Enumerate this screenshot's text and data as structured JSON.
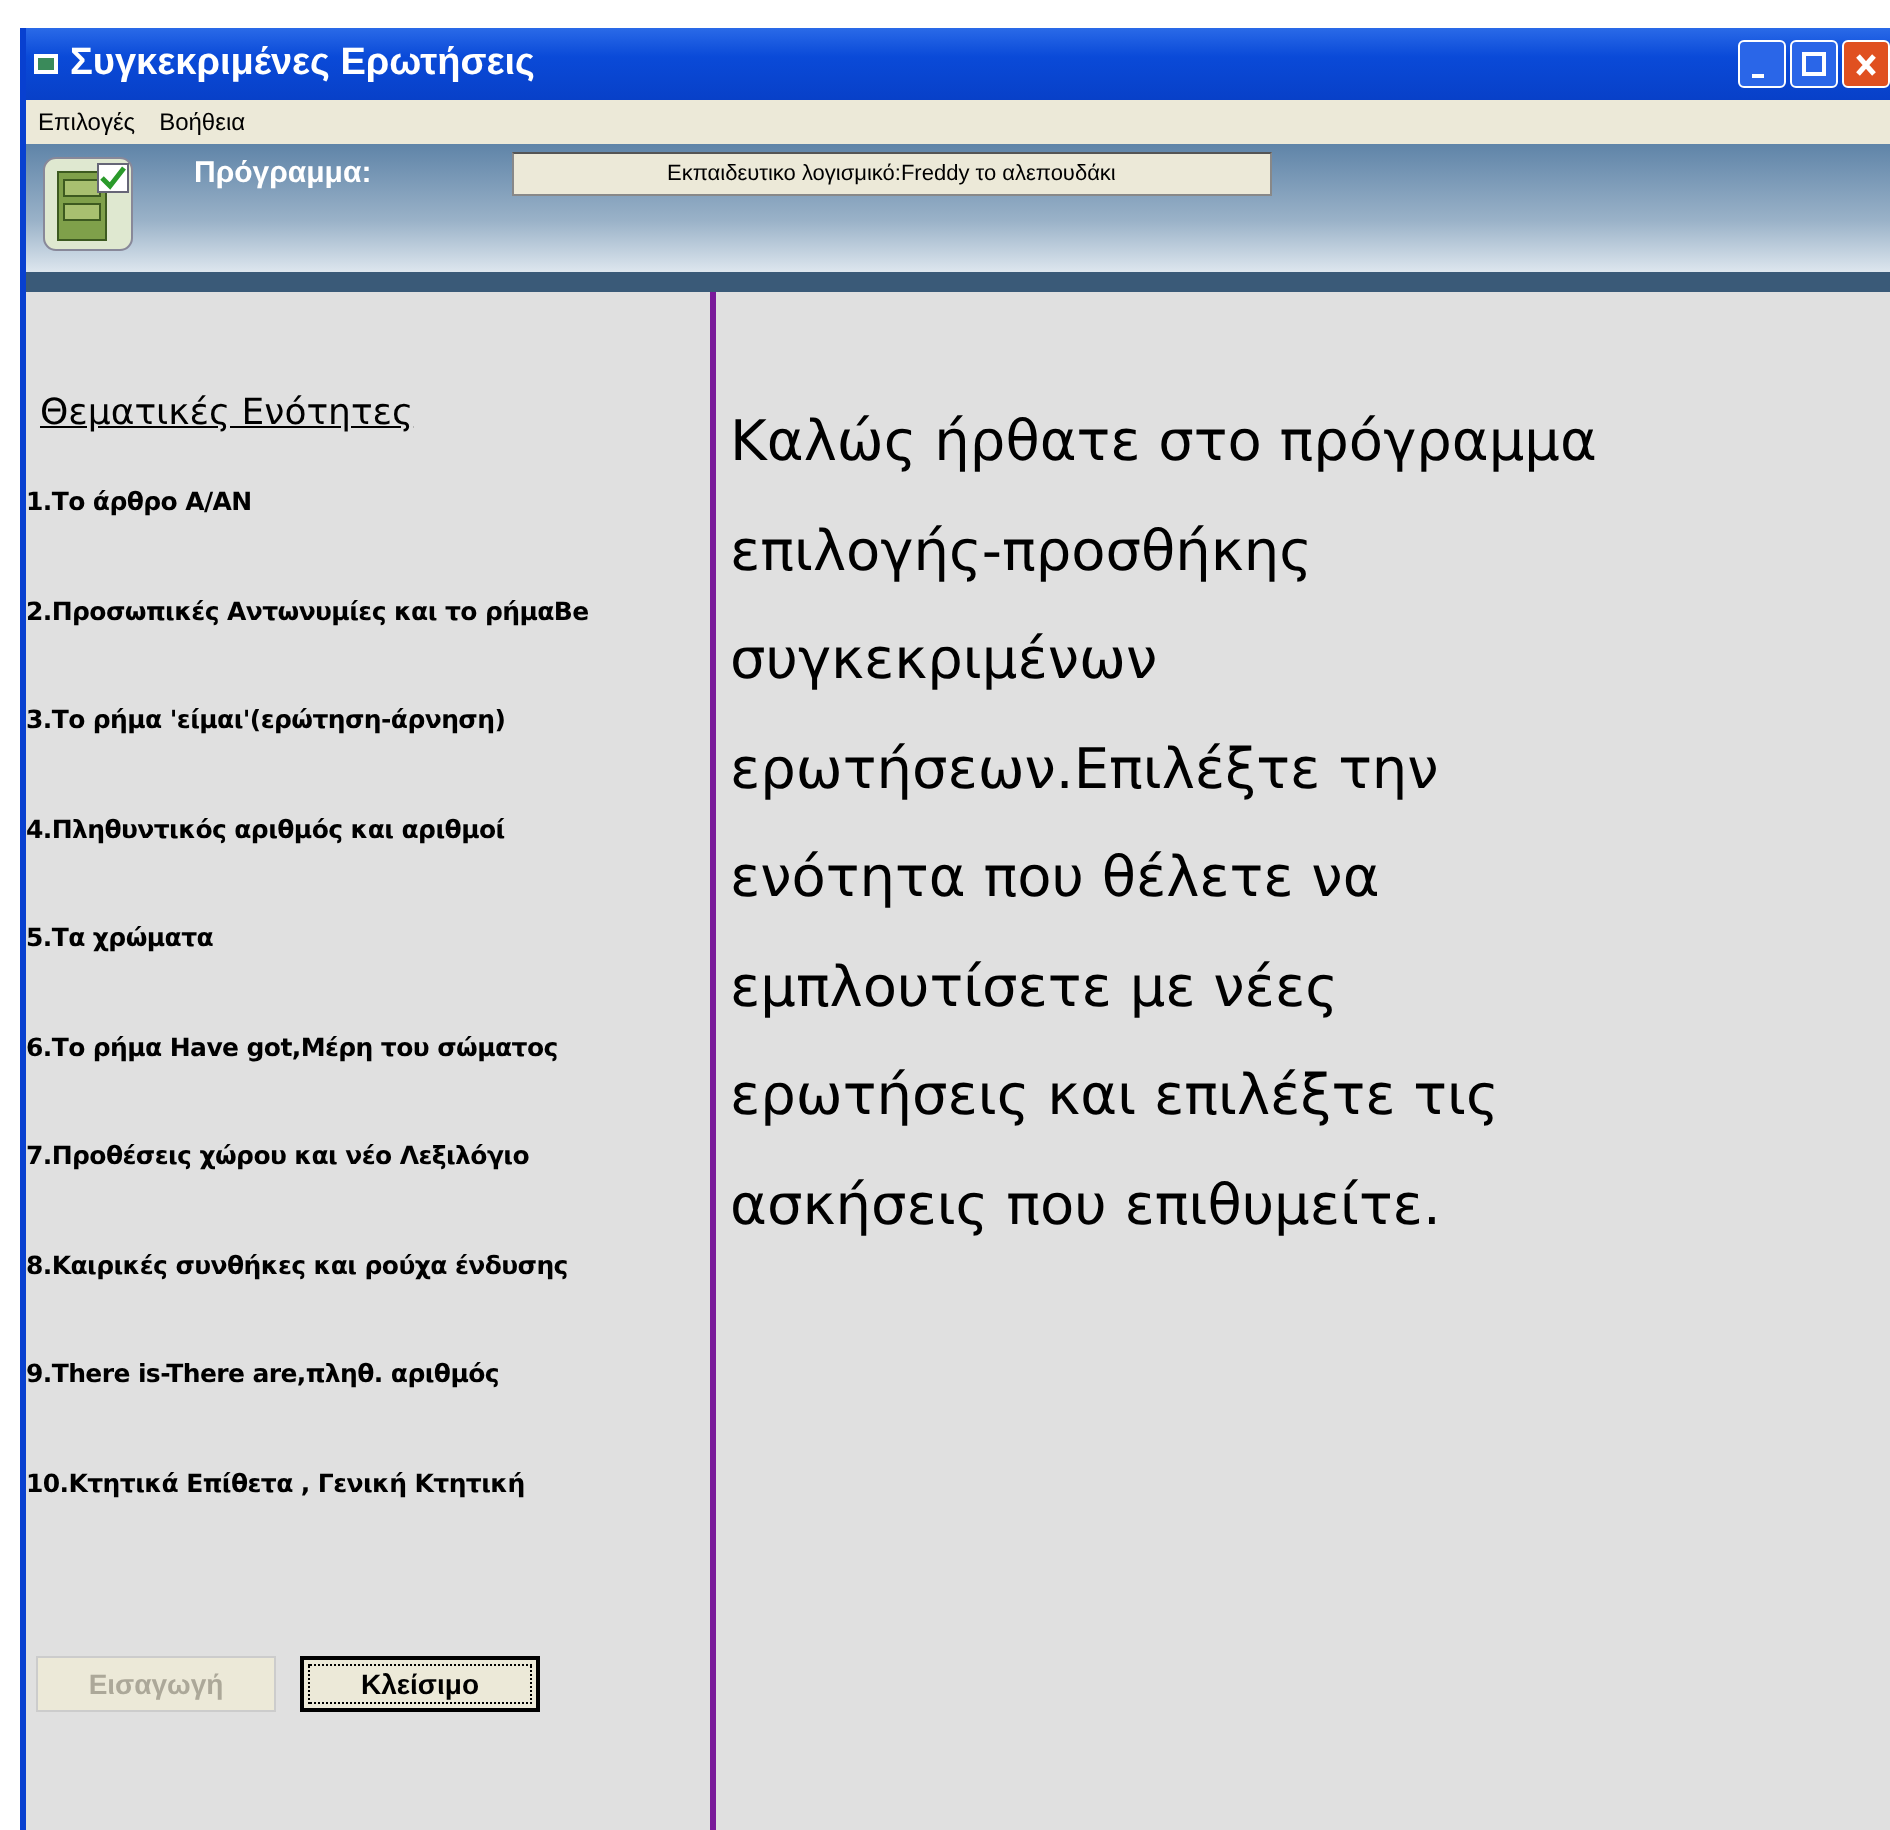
{
  "window": {
    "title": "Συγκεκριμένες Ερωτήσεις"
  },
  "menu": [
    "Επιλογές",
    "Βοήθεια"
  ],
  "header": {
    "label": "Πρόγραμμα:",
    "field_value": "Εκπαιδευτικο λογισμικό:Freddy το αλεπουδάκι"
  },
  "sidebar": {
    "heading": "Θεματικές Ενότητες",
    "items": [
      "1.Το άρθρο A/AN",
      "2.Προσωπικές Αντωνυμίες και το ρήμαBe",
      "3.Το ρήμα 'είμαι'(ερώτηση-άρνηση)",
      "4.Πληθυντικός αριθμός και αριθμοί",
      "5.Τα χρώματα",
      "6.Το ρήμα Have got,Μέρη του σώματος",
      "7.Προθέσεις χώρου και νέο Λεξιλόγιο",
      "8.Καιρικές συνθήκες και ρούχα ένδυσης",
      "9.There is-There are,πληθ. αριθμός",
      "10.Κτητικά Επίθετα , Γενική Κτητική"
    ]
  },
  "buttons": [
    {
      "label": "Εισαγωγή",
      "disabled": true
    },
    {
      "label": "Κλείσιμο",
      "disabled": false
    }
  ],
  "welcome_text": "Καλώς ήρθατε στο πρόγραμμα επιλογής-προσθήκης συγκεκριμένων ερωτήσεων.Επιλέξτε την ενότητα που θέλετε να εμπλουτίσετε με νέες ερωτήσεις και επιλέξτε τις ασκήσεις που επιθυμείτε."
}
